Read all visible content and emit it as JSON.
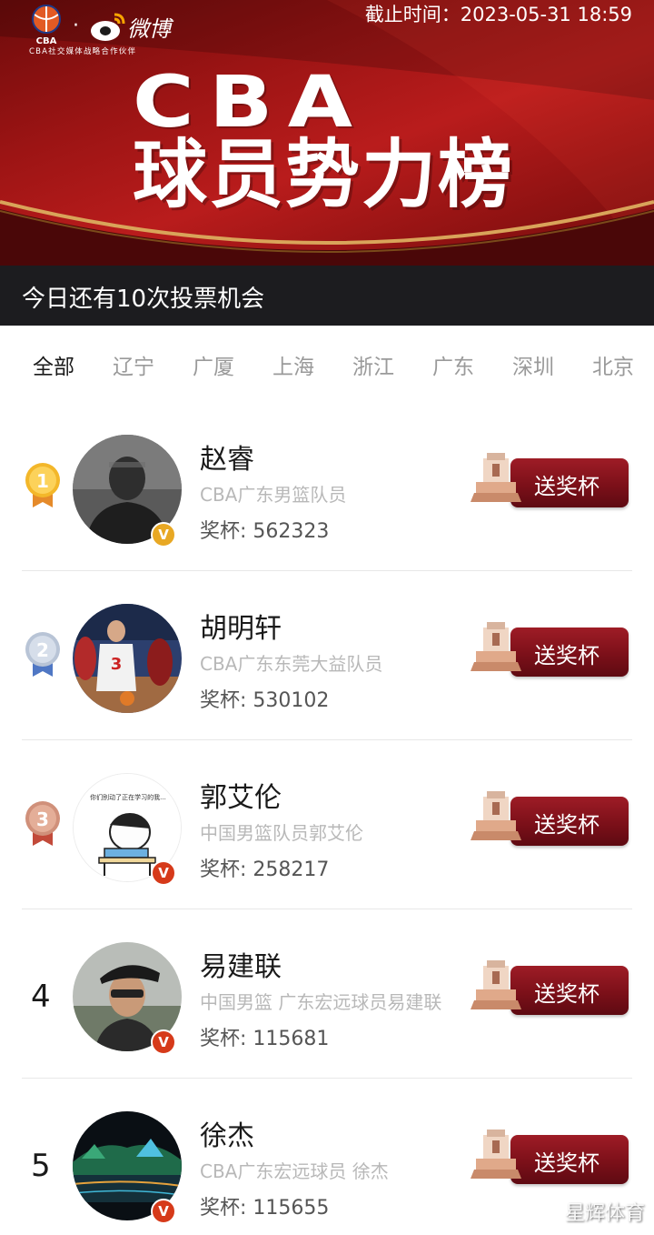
{
  "banner": {
    "deadline": "截止时间：2023-05-31 18:59",
    "partner_text": "CBA社交媒体战略合作伙伴",
    "cba_logo_text": "CBA",
    "weibo_text": "微博",
    "title_cba": "CBA",
    "title_main": "球员势力榜",
    "vote_text": "今日还有10次投票机会",
    "accent_color": "#b91c1c"
  },
  "tabs": [
    {
      "label": "全部",
      "active": true
    },
    {
      "label": "辽宁",
      "active": false
    },
    {
      "label": "广厦",
      "active": false
    },
    {
      "label": "上海",
      "active": false
    },
    {
      "label": "浙江",
      "active": false
    },
    {
      "label": "广东",
      "active": false
    },
    {
      "label": "深圳",
      "active": false
    },
    {
      "label": "北京",
      "active": false
    }
  ],
  "players": [
    {
      "rank": "1",
      "name": "赵睿",
      "desc": "CBA广东男篮队员",
      "cups": "奖杯: 562323",
      "verify": "V",
      "button": "送奖杯",
      "badge": "gold-medal"
    },
    {
      "rank": "2",
      "name": "胡明轩",
      "desc": "CBA广东东莞大益队员",
      "cups": "奖杯: 530102",
      "verify": "V",
      "button": "送奖杯",
      "badge": "silver-medal"
    },
    {
      "rank": "3",
      "name": "郭艾伦",
      "desc": "中国男篮队员郭艾伦",
      "cups": "奖杯: 258217",
      "verify": "V",
      "button": "送奖杯",
      "badge": "bronze-medal",
      "avatar_caption": "你们别动了正在学习的我..."
    },
    {
      "rank": "4",
      "name": "易建联",
      "desc": "中国男篮 广东宏远球员易建联",
      "cups": "奖杯: 115681",
      "verify": "V",
      "button": "送奖杯"
    },
    {
      "rank": "5",
      "name": "徐杰",
      "desc": "CBA广东宏远球员 徐杰",
      "cups": "奖杯: 115655",
      "verify": "V",
      "button": "送奖杯"
    }
  ],
  "watermark": "星辉体育",
  "colors": {
    "button_red": "#7c1019",
    "verify_gold": "#e8a824",
    "verify_red": "#d63a1a",
    "desc_gray": "#b8b8b8"
  }
}
